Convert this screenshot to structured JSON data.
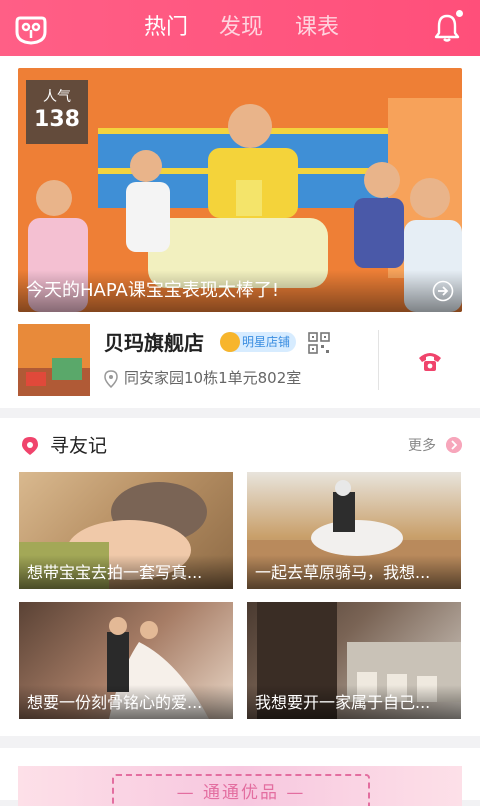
{
  "header": {
    "tabs": [
      {
        "label": "热门",
        "active": true
      },
      {
        "label": "发现",
        "active": false
      },
      {
        "label": "课表",
        "active": false
      }
    ],
    "logo_icon": "app-logo-icon",
    "bell_icon": "bell-icon",
    "accent_color": "#ff5580"
  },
  "featured": {
    "popularity_label": "人气",
    "popularity_value": "138",
    "caption": "今天的HAPA课宝宝表现太棒了!"
  },
  "store": {
    "name": "贝玛旗舰店",
    "badge": "明星店铺",
    "address": "同安家园10栋1单元802室",
    "phone_icon": "phone-icon"
  },
  "friends": {
    "title": "寻友记",
    "more": "更多",
    "items": [
      {
        "caption": "想带宝宝去拍一套写真..."
      },
      {
        "caption": "一起去草原骑马，我想..."
      },
      {
        "caption": "想要一份刻骨铭心的爱..."
      },
      {
        "caption": "我想要开一家属于自己..."
      }
    ]
  },
  "promo": {
    "text": "— 通通优品 —"
  }
}
